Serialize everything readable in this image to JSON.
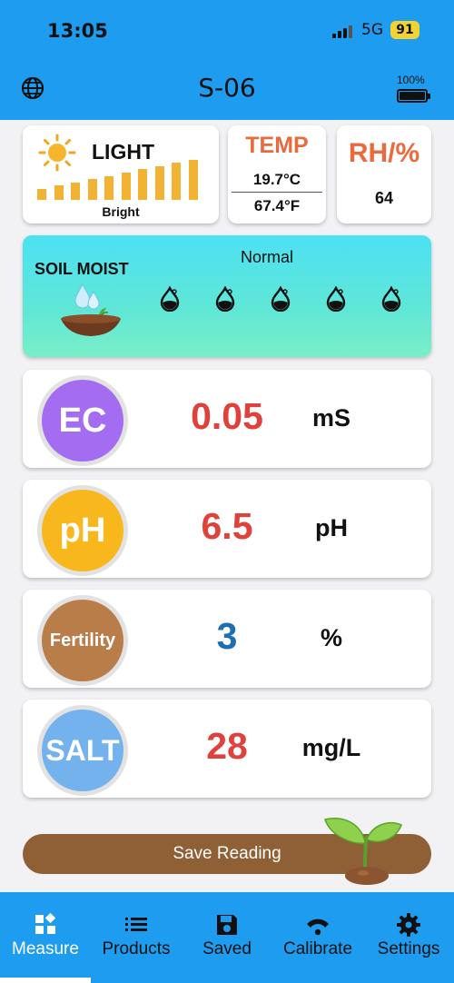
{
  "status_bar": {
    "time": "13:05",
    "network": "5G",
    "battery": "91"
  },
  "header": {
    "title": "S-06",
    "device_battery": "100%",
    "device_battery_level": 1.0,
    "accent": "#1e9df0"
  },
  "light": {
    "label": "LIGHT",
    "value": "Bright",
    "level_bars": 10
  },
  "temp": {
    "label": "TEMP",
    "celsius": "19.7°C",
    "fahrenheit": "67.4°F"
  },
  "humidity": {
    "label": "RH/%",
    "value": "64"
  },
  "soil_moist": {
    "label": "SOIL MOIST",
    "status": "Normal",
    "drop_count": 5
  },
  "metrics": [
    {
      "name": "EC",
      "value": "0.05",
      "unit": "mS",
      "circle_color": "#a36cf1",
      "value_color": "#e0413a"
    },
    {
      "name": "pH",
      "value": "6.5",
      "unit": "pH",
      "circle_color": "#f8b81d",
      "value_color": "#e0413a"
    },
    {
      "name": "Fertility",
      "value": "3",
      "unit": "%",
      "circle_color": "#b87d48",
      "value_color": "#1e6fb0"
    },
    {
      "name": "SALT",
      "value": "28",
      "unit": "mg/L",
      "circle_color": "#74b2ee",
      "value_color": "#e0413a"
    }
  ],
  "actions": {
    "save_label": "Save Reading"
  },
  "tabs": [
    {
      "label": "Measure",
      "icon": "measure-icon",
      "active": true
    },
    {
      "label": "Products",
      "icon": "list-icon",
      "active": false
    },
    {
      "label": "Saved",
      "icon": "floppy-icon",
      "active": false
    },
    {
      "label": "Calibrate",
      "icon": "calibrate-icon",
      "active": false
    },
    {
      "label": "Settings",
      "icon": "gear-icon",
      "active": false
    }
  ]
}
